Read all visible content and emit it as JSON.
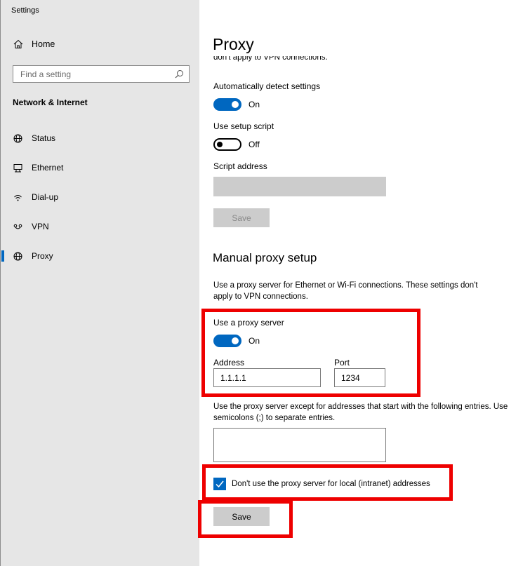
{
  "window": {
    "title": "Settings"
  },
  "sidebar": {
    "home_label": "Home",
    "search_placeholder": "Find a setting",
    "section_heading": "Network & Internet",
    "items": [
      {
        "label": "Status",
        "icon": "globe-icon"
      },
      {
        "label": "Ethernet",
        "icon": "ethernet-icon"
      },
      {
        "label": "Dial-up",
        "icon": "dialup-icon"
      },
      {
        "label": "VPN",
        "icon": "vpn-icon"
      },
      {
        "label": "Proxy",
        "icon": "globe-icon",
        "active": true
      }
    ]
  },
  "main": {
    "title": "Proxy",
    "clipped_text": "don't apply to VPN connections.",
    "automatic": {
      "detect_label": "Automatically detect settings",
      "detect_state": "On",
      "script_label": "Use setup script",
      "script_state": "Off",
      "address_label": "Script address",
      "save_label": "Save"
    },
    "manual": {
      "heading": "Manual proxy setup",
      "description": "Use a proxy server for Ethernet or Wi-Fi connections. These settings don't apply to VPN connections.",
      "use_proxy_label": "Use a proxy server",
      "use_proxy_state": "On",
      "address_label": "Address",
      "address_value": "1.1.1.1",
      "port_label": "Port",
      "port_value": "1234",
      "exceptions_description": "Use the proxy server except for addresses that start with the following entries. Use semicolons (;) to separate entries.",
      "exceptions_value": "",
      "local_checkbox_label": "Don't use the proxy server for local (intranet) addresses",
      "local_checkbox_checked": true,
      "save_label": "Save"
    }
  },
  "colors": {
    "accent": "#0067c0",
    "annotation": "#ee0000",
    "sidebar_bg": "#e6e6e6"
  }
}
